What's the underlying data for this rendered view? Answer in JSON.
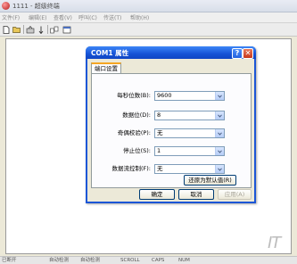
{
  "window": {
    "title": "1111 - 超级终端"
  },
  "menubar": {
    "items": [
      "文件(F)",
      "编辑(E)",
      "查看(V)",
      "呼叫(C)",
      "传送(T)",
      "帮助(H)"
    ]
  },
  "toolbar": {
    "icons": [
      "new-icon",
      "open-icon",
      "connect-icon",
      "disconnect-icon",
      "send-icon",
      "properties-icon"
    ]
  },
  "dialog": {
    "title": "COM1 属性",
    "tab_label": "端口设置",
    "fields": [
      {
        "label": "每秒位数(B):",
        "value": "9600"
      },
      {
        "label": "数据位(D):",
        "value": "8"
      },
      {
        "label": "奇偶校验(P):",
        "value": "无"
      },
      {
        "label": "停止位(S):",
        "value": "1"
      },
      {
        "label": "数据流控制(F):",
        "value": "无"
      }
    ],
    "restore_defaults_label": "还原为默认值(R)",
    "ok_label": "确定",
    "cancel_label": "取消",
    "apply_label": "应用(A)",
    "help_button_label": "?",
    "close_button_label": "✕"
  },
  "statusbar": {
    "cells": [
      "已断开",
      "自动检测",
      "自动检测",
      "SCROLL",
      "CAPS",
      "NUM"
    ]
  },
  "watermark": "IT"
}
